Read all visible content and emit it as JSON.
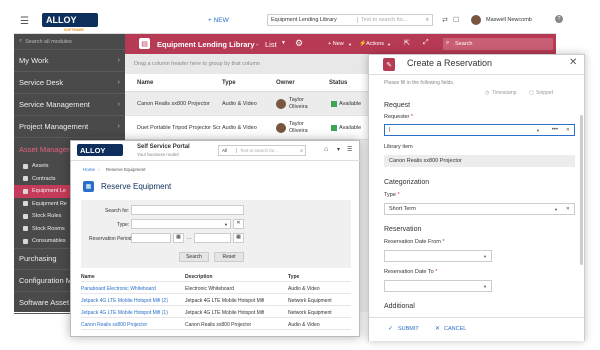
{
  "topbar": {
    "logo_text": "ALLOY",
    "logo_sub": "SOFTWARE",
    "new_label": "+ NEW",
    "search_scope": "Equipment Lending Library",
    "search_placeholder": "Text to search for...",
    "user_name": "Maxwell Newcomb"
  },
  "sidebar": {
    "search_placeholder": "Search all modules",
    "items": [
      {
        "label": "My Work"
      },
      {
        "label": "Service Desk"
      },
      {
        "label": "Service Management"
      },
      {
        "label": "Project Management"
      },
      {
        "label": "Asset Management"
      }
    ],
    "sub_items": [
      {
        "label": "Assets"
      },
      {
        "label": "Contracts"
      },
      {
        "label": "Equipment Le"
      },
      {
        "label": "Equipment Re"
      },
      {
        "label": "Stock Rules"
      },
      {
        "label": "Stock Rooms"
      },
      {
        "label": "Consumables"
      }
    ],
    "bottom_items": [
      {
        "label": "Purchasing"
      },
      {
        "label": "Configuration M"
      },
      {
        "label": "Software Asset"
      }
    ]
  },
  "list": {
    "title": "Equipment Lending Library",
    "view": "List",
    "new_label": "+ New",
    "actions_label": "Actions",
    "search_placeholder": "Search",
    "group_hint": "Drag a column header here to group by that column",
    "columns": [
      "Name",
      "Type",
      "Owner",
      "Status"
    ],
    "rows": [
      {
        "name": "Canon Realis sx800 Projector",
        "type": "Audio & Video",
        "owner": "Taylor Oliveira",
        "status": "Available"
      },
      {
        "name": "Duet Portable Tripod Projector Scr",
        "type": "Audio & Video",
        "owner": "Taylor Oliveira",
        "status": "Available"
      }
    ]
  },
  "modal": {
    "title": "Create a Reservation",
    "hint": "Please fill in the following fields.",
    "timestamp_label": "Timestamp",
    "snippet_label": "Snippet",
    "section_request": "Request",
    "requester_label": "Requester",
    "library_item_label": "Library item",
    "library_item_value": "Canon Realis sx800 Projector",
    "section_categorization": "Categorization",
    "type_label": "Type",
    "type_value": "Short Term",
    "section_reservation": "Reservation",
    "date_from_label": "Reservation Date From",
    "date_to_label": "Reservation Date To",
    "section_additional": "Additional",
    "submit_label": "SUBMIT",
    "cancel_label": "CANCEL"
  },
  "portal": {
    "title": "Self Service Portal",
    "subtitle": "Your business model",
    "scope": "All",
    "search_placeholder": "Text to search for...",
    "breadcrumb_home": "Home",
    "breadcrumb_current": "Reserve Equipment",
    "page_title": "Reserve Equipment",
    "search_for_label": "Search for:",
    "type_label": "Type:",
    "period_label": "Reservation Period:",
    "period_separator": "...",
    "search_button": "Search",
    "reset_button": "Reset",
    "columns": [
      "Name",
      "Description",
      "Type"
    ],
    "rows": [
      {
        "name": "Panaboard Electronic Whiteboard",
        "description": "Electronic Whiteboard",
        "type": "Audio & Video"
      },
      {
        "name": "Jetpack 4G LTE Mobile Hotspot Mifi (2)",
        "description": "Jetpack 4G LTE Mobile Hotspot Mifi",
        "type": "Network Equipment"
      },
      {
        "name": "Jetpack 4G LTE Mobile Hotspot Mifi (1)",
        "description": "Jetpack 4G LTE Mobile Hotspot Mifi",
        "type": "Network Equipment"
      },
      {
        "name": "Canon Realis sx800 Projector",
        "description": "Canon Realis sx800 Projector",
        "type": "Audio & Video"
      }
    ]
  },
  "colors": {
    "accent": "#b63a53",
    "nav": "#4a4a4a",
    "modal_accent": "#2a6fc9",
    "brand": "#0e2f5c"
  }
}
